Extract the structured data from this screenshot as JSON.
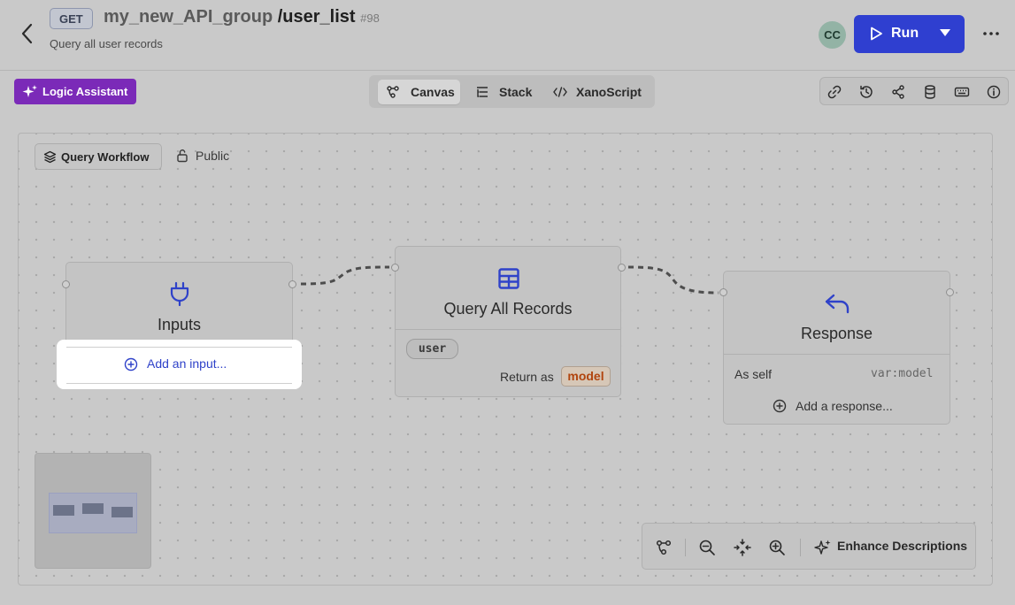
{
  "header": {
    "method": "GET",
    "group": "my_new_API_group",
    "path": "/user_list",
    "id": "#98",
    "subtitle": "Query all user records",
    "avatar_initials": "CC",
    "run_label": "Run"
  },
  "toolbar": {
    "logic_assistant": "Logic Assistant",
    "views": [
      {
        "label": "Canvas",
        "active": true
      },
      {
        "label": "Stack",
        "active": false
      },
      {
        "label": "XanoScript",
        "active": false
      }
    ],
    "right_icons": [
      "link-icon",
      "history-icon",
      "share-icon",
      "database-icon",
      "keyboard-icon",
      "info-icon"
    ]
  },
  "canvas": {
    "workflow_label": "Query Workflow",
    "visibility": "Public",
    "nodes": {
      "inputs": {
        "title": "Inputs",
        "add_label": "Add an input..."
      },
      "query": {
        "title": "Query All Records",
        "table": "user",
        "return_as_label": "Return as",
        "return_as_value": "model"
      },
      "response": {
        "title": "Response",
        "as_self_label": "As self",
        "as_self_value": "var:model",
        "add_label": "Add a response..."
      }
    },
    "bottom_toolbar": {
      "enhance_label": "Enhance Descriptions"
    }
  },
  "colors": {
    "run_button": "#2f3fd0",
    "logic_assistant": "#7b2ab8",
    "accent_link": "#2f42c9",
    "model_chip_text": "#b1450e"
  }
}
